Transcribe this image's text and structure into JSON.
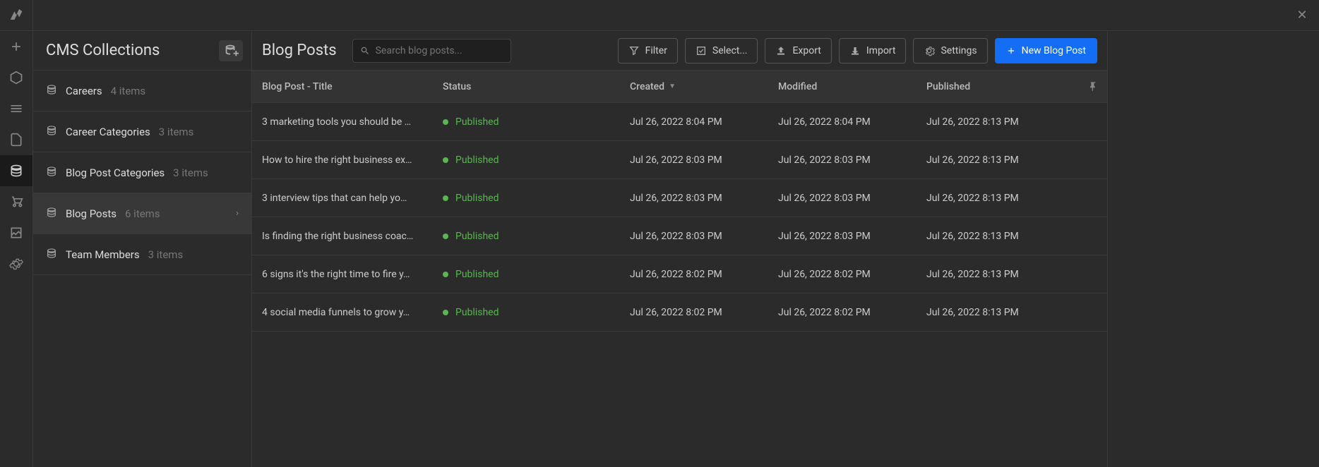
{
  "sidebar": {
    "title": "CMS Collections",
    "collections": [
      {
        "name": "Careers",
        "count": "4 items"
      },
      {
        "name": "Career Categories",
        "count": "3 items"
      },
      {
        "name": "Blog Post Categories",
        "count": "3 items"
      },
      {
        "name": "Blog Posts",
        "count": "6 items"
      },
      {
        "name": "Team Members",
        "count": "3 items"
      }
    ]
  },
  "panel": {
    "title": "Blog Posts",
    "search_placeholder": "Search blog posts...",
    "buttons": {
      "filter": "Filter",
      "select": "Select...",
      "export": "Export",
      "import": "Import",
      "settings": "Settings",
      "new": "New Blog Post"
    },
    "columns": {
      "title": "Blog Post - Title",
      "status": "Status",
      "created": "Created",
      "modified": "Modified",
      "published": "Published"
    },
    "rows": [
      {
        "title": "3 marketing tools you should be …",
        "status": "Published",
        "created": "Jul 26, 2022 8:04 PM",
        "modified": "Jul 26, 2022 8:04 PM",
        "published": "Jul 26, 2022 8:13 PM"
      },
      {
        "title": "How to hire the right business ex…",
        "status": "Published",
        "created": "Jul 26, 2022 8:03 PM",
        "modified": "Jul 26, 2022 8:03 PM",
        "published": "Jul 26, 2022 8:13 PM"
      },
      {
        "title": "3 interview tips that can help yo…",
        "status": "Published",
        "created": "Jul 26, 2022 8:03 PM",
        "modified": "Jul 26, 2022 8:03 PM",
        "published": "Jul 26, 2022 8:13 PM"
      },
      {
        "title": "Is finding the right business coac…",
        "status": "Published",
        "created": "Jul 26, 2022 8:03 PM",
        "modified": "Jul 26, 2022 8:03 PM",
        "published": "Jul 26, 2022 8:13 PM"
      },
      {
        "title": "6 signs it's the right time to fire y…",
        "status": "Published",
        "created": "Jul 26, 2022 8:02 PM",
        "modified": "Jul 26, 2022 8:02 PM",
        "published": "Jul 26, 2022 8:13 PM"
      },
      {
        "title": "4 social media funnels to grow y…",
        "status": "Published",
        "created": "Jul 26, 2022 8:02 PM",
        "modified": "Jul 26, 2022 8:02 PM",
        "published": "Jul 26, 2022 8:13 PM"
      }
    ]
  }
}
